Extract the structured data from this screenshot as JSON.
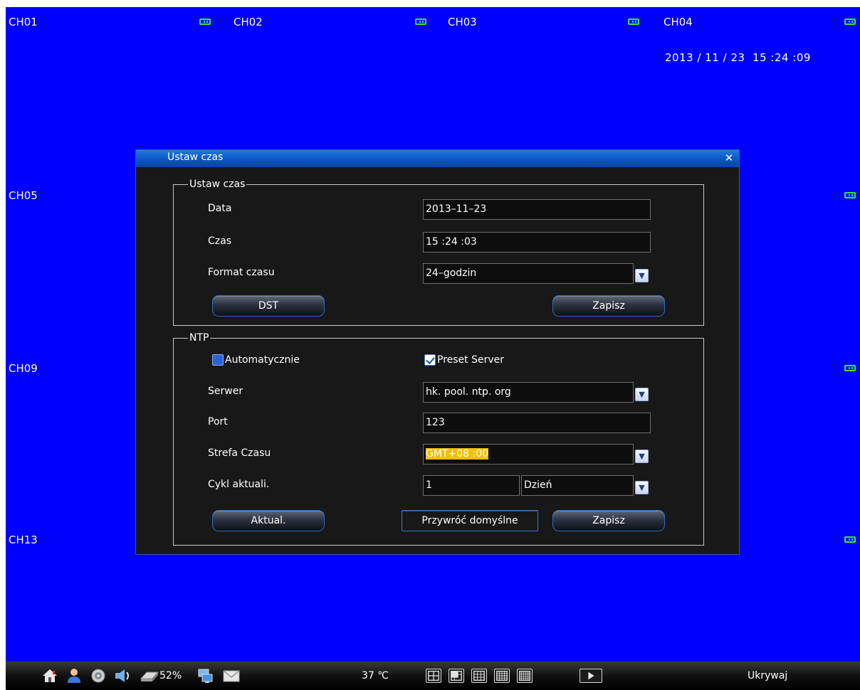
{
  "osd": {
    "channels": {
      "ch01": "CH01",
      "ch02": "CH02",
      "ch03": "CH03",
      "ch04": "CH04",
      "ch05": "CH05",
      "ch09": "CH09",
      "ch13": "CH13"
    },
    "datetime": "2013 / 11 / 23  15 :24 :09",
    "record_icon": "record-status-icon",
    "background_color": "#0000ff"
  },
  "dialog": {
    "title": "Ustaw czas",
    "close_icon": "close-icon",
    "time_group": {
      "title": "Ustaw czas",
      "date_label": "Data",
      "date_value": "2013–11–23",
      "time_label": "Czas",
      "time_value": "15 :24 :03",
      "format_label": "Format czasu",
      "format_value": "24–godzin",
      "dst_label": "DST",
      "save_label": "Zapisz"
    },
    "ntp_group": {
      "title": "NTP",
      "auto_label": "Automatycznie",
      "auto_checked": false,
      "preset_label": "Preset Server",
      "preset_checked": true,
      "server_label": "Serwer",
      "server_value": "hk. pool. ntp. org",
      "port_label": "Port",
      "port_value": "123",
      "timezone_label": "Strefa Czasu",
      "timezone_value": "GMT+08 :00",
      "cycle_label": "Cykl aktuali.",
      "cycle_value": "1",
      "cycle_unit": "Dzień",
      "update_label": "Aktual.",
      "restore_label": "Przywróć  domyślne",
      "save_label": "Zapisz"
    }
  },
  "taskbar": {
    "disk_usage": "52%",
    "temperature": "37  ℃",
    "hide_label": "Ukrywaj",
    "icons": [
      "home-icon",
      "user-icon",
      "alarm-icon",
      "audio-icon",
      "disk-icon",
      "network-icon",
      "mail-icon",
      "play-icon"
    ],
    "layouts": [
      "layout-1-icon",
      "layout-4-icon",
      "layout-9-icon",
      "layout-16-icon",
      "layout-25-icon"
    ]
  }
}
